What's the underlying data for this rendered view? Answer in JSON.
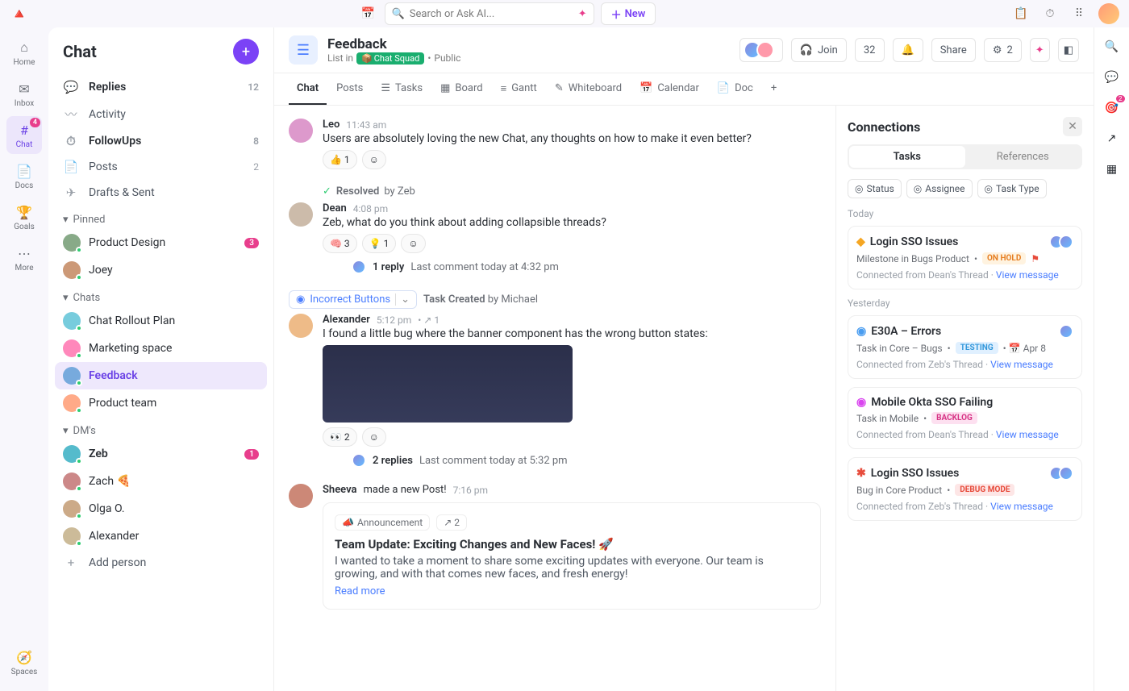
{
  "topbar": {
    "search_placeholder": "Search or Ask AI...",
    "new_label": "New"
  },
  "rail": [
    {
      "id": "home",
      "label": "Home"
    },
    {
      "id": "inbox",
      "label": "Inbox"
    },
    {
      "id": "chat",
      "label": "Chat",
      "badge": "4",
      "active": true
    },
    {
      "id": "docs",
      "label": "Docs"
    },
    {
      "id": "goals",
      "label": "Goals"
    },
    {
      "id": "more",
      "label": "More"
    },
    {
      "id": "spaces",
      "label": "Spaces"
    }
  ],
  "sidebar": {
    "title": "Chat",
    "top_items": [
      {
        "icon": "💬",
        "label": "Replies",
        "count": "12",
        "bold": true
      },
      {
        "icon": "〰",
        "label": "Activity"
      },
      {
        "icon": "⏱",
        "label": "FollowUps",
        "count": "8",
        "bold": true
      },
      {
        "icon": "📄",
        "label": "Posts",
        "count": "2"
      },
      {
        "icon": "✈",
        "label": "Drafts & Sent"
      }
    ],
    "sections": {
      "pinned": {
        "label": "Pinned",
        "items": [
          {
            "label": "Product Design",
            "pill": "3",
            "avatar": "#8a8"
          },
          {
            "label": "Joey",
            "avatar": "#c97"
          }
        ]
      },
      "chats": {
        "label": "Chats",
        "items": [
          {
            "label": "Chat Rollout Plan",
            "avatar": "#7cd"
          },
          {
            "label": "Marketing space",
            "avatar": "#f8b"
          },
          {
            "label": "Feedback",
            "avatar": "#7ad",
            "selected": true
          },
          {
            "label": "Product team",
            "avatar": "#fa8"
          }
        ]
      },
      "dms": {
        "label": "DM's",
        "items": [
          {
            "label": "Zeb",
            "pill": "1",
            "avatar": "#5bc",
            "bold": true
          },
          {
            "label": "Zach 🍕",
            "avatar": "#c88"
          },
          {
            "label": "Olga O.",
            "avatar": "#ca8"
          },
          {
            "label": "Alexander",
            "avatar": "#cb9"
          }
        ]
      },
      "add_person": "Add person"
    }
  },
  "header": {
    "title": "Feedback",
    "subtitle_prefix": "List in",
    "space": "Chat Squad",
    "visibility": "Public",
    "join_label": "Join",
    "member_count": "32",
    "share_label": "Share",
    "auto_count": "2"
  },
  "tabs": [
    "Chat",
    "Posts",
    "Tasks",
    "Board",
    "Gantt",
    "Whiteboard",
    "Calendar",
    "Doc"
  ],
  "active_tab": "Chat",
  "feed": [
    {
      "type": "message",
      "author": "Leo",
      "time": "11:43 am",
      "text": "Users are absolutely loving the new Chat, any thoughts on how to make it even better?",
      "reactions": [
        {
          "emoji": "👍",
          "count": "1"
        }
      ],
      "av": "#d9c"
    },
    {
      "type": "resolved",
      "by_label": "Resolved",
      "by": "by Zeb"
    },
    {
      "type": "message",
      "author": "Dean",
      "time": "4:08 pm",
      "text": "Zeb, what do you think about adding collapsible threads?",
      "reactions": [
        {
          "emoji": "🧠",
          "count": "3"
        },
        {
          "emoji": "💡",
          "count": "1"
        }
      ],
      "reply": {
        "count": "1 reply",
        "last": "Last comment today at 4:32 pm"
      },
      "av": "#cba"
    },
    {
      "type": "task_created",
      "pill": "Incorrect Buttons",
      "label": "Task Created",
      "by": "by Michael"
    },
    {
      "type": "message",
      "author": "Alexander",
      "time": "5:12 pm",
      "link_count": "1",
      "text": "I found a little bug where the banner component has the wrong button states:",
      "image": true,
      "reactions": [
        {
          "emoji": "👀",
          "count": "2"
        }
      ],
      "reply": {
        "count": "2 replies",
        "last": "Last comment today at 5:32 pm"
      },
      "av": "#eb8"
    },
    {
      "type": "post",
      "author": "Sheeva",
      "action": "made a new Post!",
      "time": "7:16 pm",
      "tag": "Announcement",
      "link_count": "2",
      "title": "Team Update: Exciting Changes and New Faces! 🚀",
      "body": "I wanted to take a moment to share some exciting updates with everyone. Our team is growing, and with that comes new faces, and fresh energy!",
      "read_more": "Read more",
      "av": "#c87"
    }
  ],
  "panel": {
    "title": "Connections",
    "tabs": [
      "Tasks",
      "References"
    ],
    "active": "Tasks",
    "filters": [
      "Status",
      "Assignee",
      "Task Type"
    ],
    "groups": [
      {
        "label": "Today",
        "cards": [
          {
            "icon": "◆",
            "icon_color": "#f5a623",
            "title": "Login SSO Issues",
            "sub": "Milestone in Bugs Product",
            "badge": "ON HOLD",
            "badge_class": "on-hold",
            "flag": true,
            "avatars": 2,
            "from": "Connected from Dean's Thread",
            "view": "View message"
          }
        ]
      },
      {
        "label": "Yesterday",
        "cards": [
          {
            "icon": "◉",
            "icon_color": "#4a9df0",
            "title": "E30A – Errors",
            "sub": "Task in Core – Bugs",
            "badge": "TESTING",
            "badge_class": "testing",
            "date": "Apr 8",
            "avatars": 1,
            "from": "Connected from Zeb's Thread",
            "view": "View message"
          },
          {
            "icon": "◉",
            "icon_color": "#d946ef",
            "title": "Mobile Okta SSO Failing",
            "sub": "Task in Mobile",
            "badge": "BACKLOG",
            "badge_class": "backlog",
            "from": "Connected from Dean's Thread",
            "view": "View message"
          },
          {
            "icon": "✱",
            "icon_color": "#e74c3c",
            "title": "Login SSO Issues",
            "sub": "Bug in Core Product",
            "badge": "DEBUG MODE",
            "badge_class": "debug",
            "avatars": 2,
            "from": "Connected from Zeb's Thread",
            "view": "View message"
          }
        ]
      }
    ]
  },
  "right_rail_badge": "2"
}
